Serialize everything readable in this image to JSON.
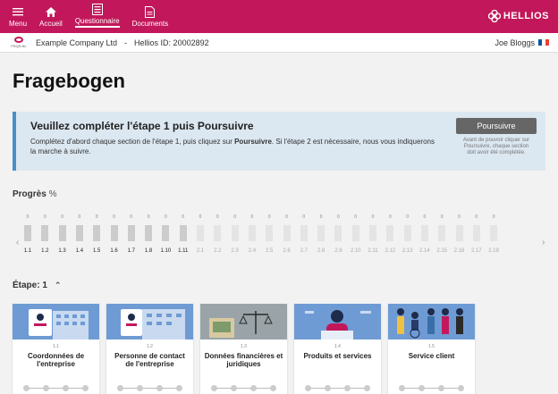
{
  "nav": {
    "items": [
      {
        "label": "Menu",
        "icon": "hamburger-icon"
      },
      {
        "label": "Accueil",
        "icon": "home-icon"
      },
      {
        "label": "Questionnaire",
        "icon": "list-icon",
        "active": true
      },
      {
        "label": "Documents",
        "icon": "document-icon"
      }
    ],
    "brand": "HELLIOS",
    "color": "#c2185b"
  },
  "company": {
    "logo_text": "FSQS-NL",
    "name": "Example Company Ltd",
    "separator": "-",
    "hellios_id": "Hellios ID:  20002892",
    "user": "Joe Bloggs"
  },
  "page_title": "Fragebogen",
  "banner": {
    "title": "Veuillez compléter l'étape 1 puis Poursuivre",
    "body_pre": "Complétez d'abord chaque section de l'étape 1, puis cliquez sur ",
    "body_bold": "Poursuivre",
    "body_post": ". Si l'étape 2 est nécessaire, nous vous indiquerons la marche à suivre.",
    "button": "Poursuivre",
    "button_note": "Avant de pouvoir cliquer sur Poursuivre, chaque section doit avoir été complétée."
  },
  "progress": {
    "label": "Progrès",
    "unit": "%",
    "steps": [
      {
        "label": "1.1",
        "value": "0"
      },
      {
        "label": "1.2",
        "value": "0"
      },
      {
        "label": "1.3",
        "value": "0"
      },
      {
        "label": "1.4",
        "value": "0"
      },
      {
        "label": "1.5",
        "value": "0"
      },
      {
        "label": "1.6",
        "value": "0"
      },
      {
        "label": "1.7",
        "value": "0"
      },
      {
        "label": "1.8",
        "value": "0"
      },
      {
        "label": "1.10",
        "value": "0"
      },
      {
        "label": "1.11",
        "value": "0"
      },
      {
        "label": "2.1",
        "value": "0"
      },
      {
        "label": "2.2",
        "value": "0"
      },
      {
        "label": "2.3",
        "value": "0"
      },
      {
        "label": "2.4",
        "value": "0"
      },
      {
        "label": "2.5",
        "value": "0"
      },
      {
        "label": "2.6",
        "value": "0"
      },
      {
        "label": "2.7",
        "value": "0"
      },
      {
        "label": "2.8",
        "value": "0"
      },
      {
        "label": "2.9",
        "value": "0"
      },
      {
        "label": "2.10",
        "value": "0"
      },
      {
        "label": "2.11",
        "value": "0"
      },
      {
        "label": "2.12",
        "value": "0"
      },
      {
        "label": "2.13",
        "value": "0"
      },
      {
        "label": "2.14",
        "value": "0"
      },
      {
        "label": "2.15",
        "value": "0"
      },
      {
        "label": "2.16",
        "value": "0"
      },
      {
        "label": "2.17",
        "value": "0"
      },
      {
        "label": "2.18",
        "value": "0"
      }
    ]
  },
  "etape": {
    "label": "Étape: 1"
  },
  "cards": [
    {
      "num": "1.1",
      "title": "Coordonnées de l'entreprise",
      "image": "building-icon"
    },
    {
      "num": "1.2",
      "title": "Personne de contact de l'entreprise",
      "image": "contact-icon"
    },
    {
      "num": "1.3",
      "title": "Données financières et juridiques",
      "image": "finance-icon"
    },
    {
      "num": "1.4",
      "title": "Produits et services",
      "image": "support-agent-icon"
    },
    {
      "num": "1.5",
      "title": "Service client",
      "image": "people-icon"
    }
  ]
}
